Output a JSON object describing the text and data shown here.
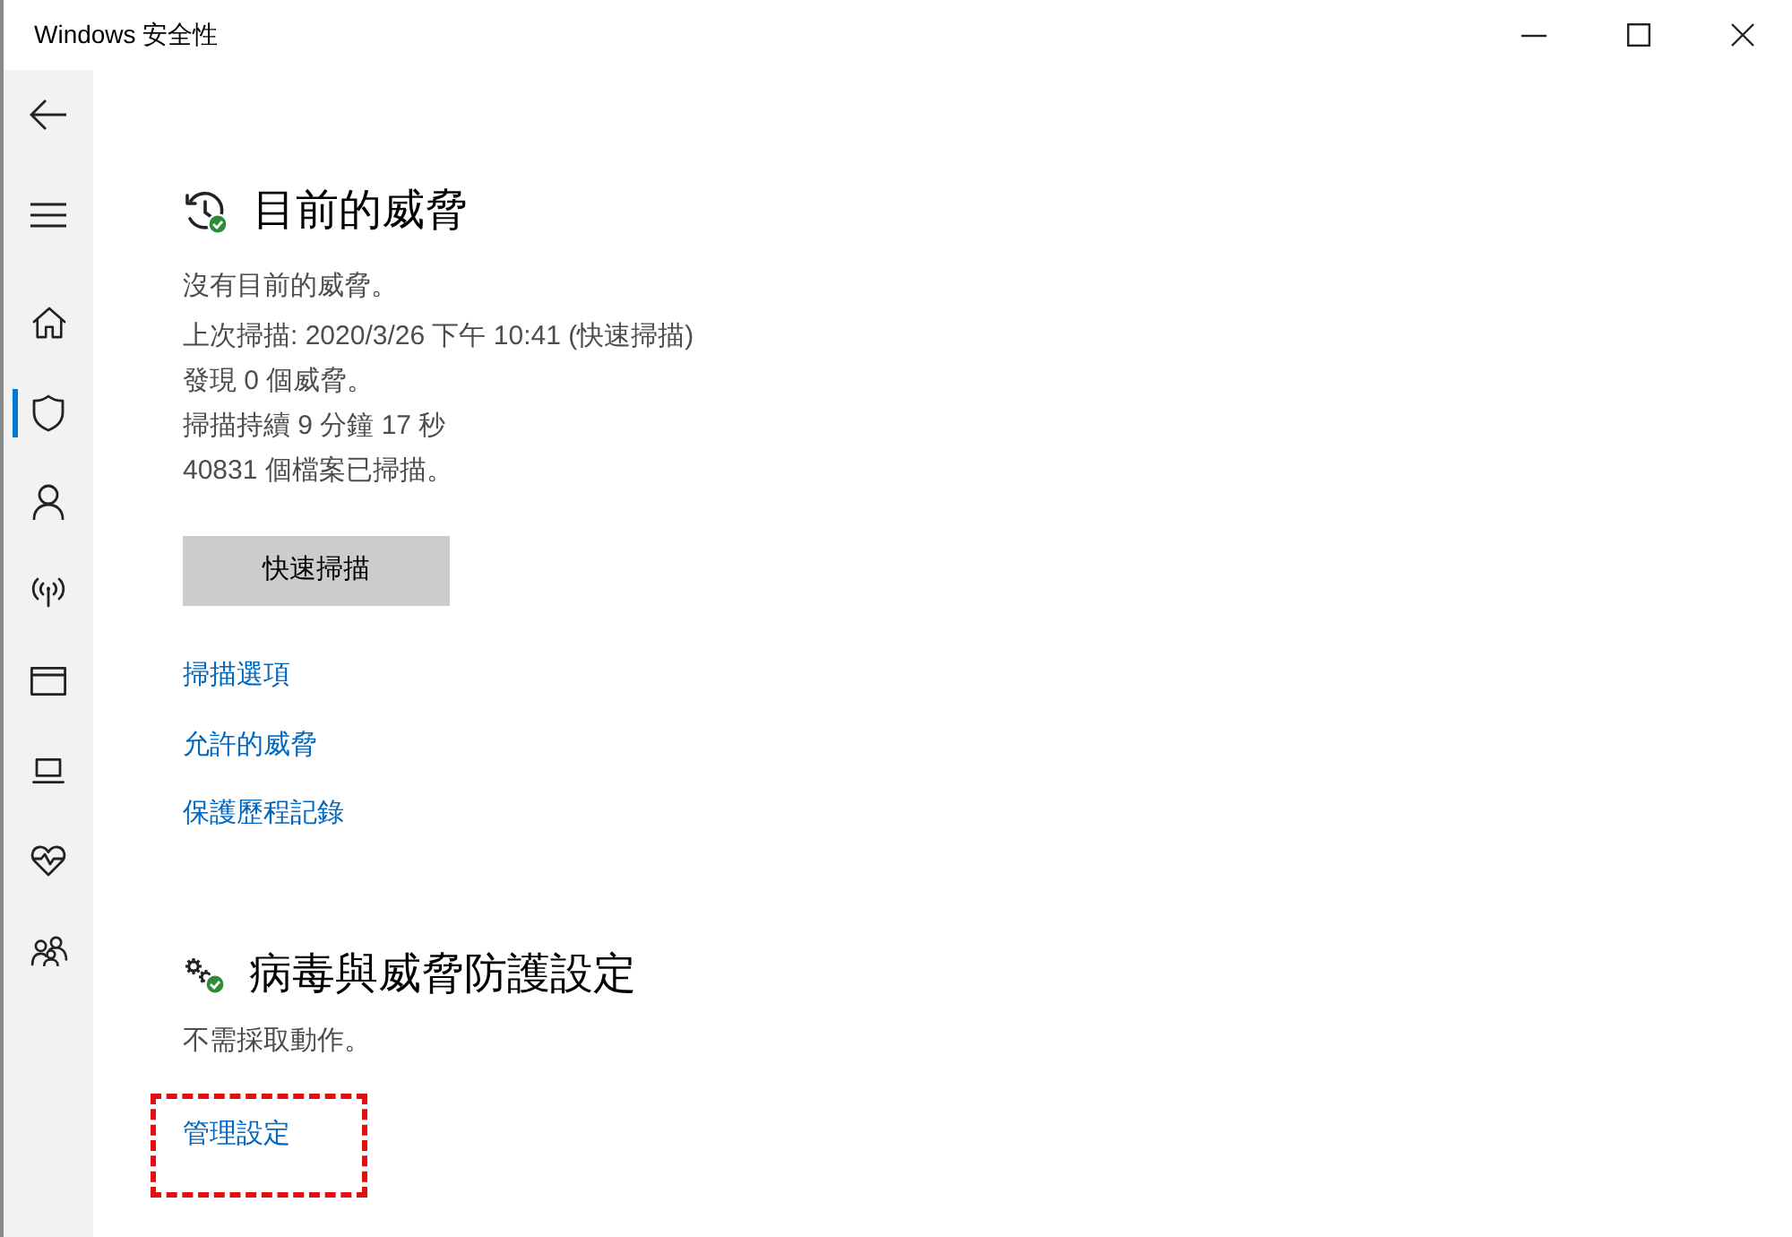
{
  "window": {
    "title": "Windows 安全性"
  },
  "nav_items": [
    {
      "kind": "home",
      "selected": false
    },
    {
      "kind": "shield",
      "selected": true
    },
    {
      "kind": "account",
      "selected": false
    },
    {
      "kind": "network",
      "selected": false
    },
    {
      "kind": "app",
      "selected": false
    },
    {
      "kind": "device",
      "selected": false
    },
    {
      "kind": "health",
      "selected": false
    },
    {
      "kind": "family",
      "selected": false
    }
  ],
  "sections": [
    {
      "kind": "history",
      "title": "目前的威脅",
      "status": "沒有目前的威脅。",
      "details": [
        "上次掃描: 2020/3/26 下午 10:41 (快速掃描)",
        "發現 0 個威脅。",
        "掃描持續 9 分鐘 17 秒",
        "40831 個檔案已掃描。"
      ],
      "button": "快速掃描",
      "links": [
        {
          "label": "掃描選項",
          "highlighted": false
        },
        {
          "label": "允許的威脅",
          "highlighted": false
        },
        {
          "label": "保護歷程記錄",
          "highlighted": false
        }
      ]
    },
    {
      "kind": "settings",
      "title": "病毒與威脅防護設定",
      "status": "不需採取動作。",
      "links": [
        {
          "label": "管理設定",
          "highlighted": true
        }
      ]
    }
  ]
}
